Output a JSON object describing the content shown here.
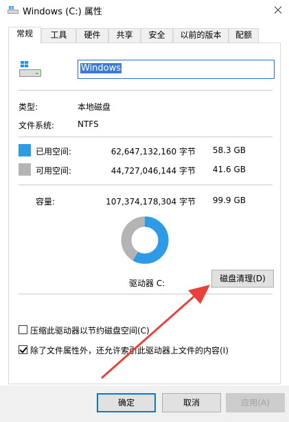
{
  "window": {
    "title": "Windows (C:) 属性"
  },
  "tabs": [
    {
      "label": "常规"
    },
    {
      "label": "工具"
    },
    {
      "label": "硬件"
    },
    {
      "label": "共享"
    },
    {
      "label": "安全"
    },
    {
      "label": "以前的版本"
    },
    {
      "label": "配额"
    }
  ],
  "drive": {
    "name": "Windows"
  },
  "info": {
    "type_label": "类型:",
    "type_value": "本地磁盘",
    "fs_label": "文件系统:",
    "fs_value": "NTFS"
  },
  "usage": {
    "used_label": "已用空间:",
    "used_bytes": "62,647,132,160 字节",
    "used_size": "58.3 GB",
    "free_label": "可用空间:",
    "free_bytes": "44,727,046,144 字节",
    "free_size": "41.6 GB",
    "capacity_label": "容量:",
    "capacity_bytes": "107,374,178,304 字节",
    "capacity_size": "99.9 GB",
    "used_fraction": 0.583
  },
  "drive_label": "驱动器 C:",
  "buttons": {
    "cleanup": "磁盘清理(D)",
    "ok": "确定",
    "cancel": "取消",
    "apply": "应用(A)"
  },
  "options": {
    "compress": "压缩此驱动器以节约磁盘空间(C)",
    "index": "除了文件属性外，还允许索引此驱动器上文件的内容(I)"
  },
  "colors": {
    "used": "#2e9be6",
    "free": "#b4b4b4",
    "arrow": "#e8413b"
  }
}
